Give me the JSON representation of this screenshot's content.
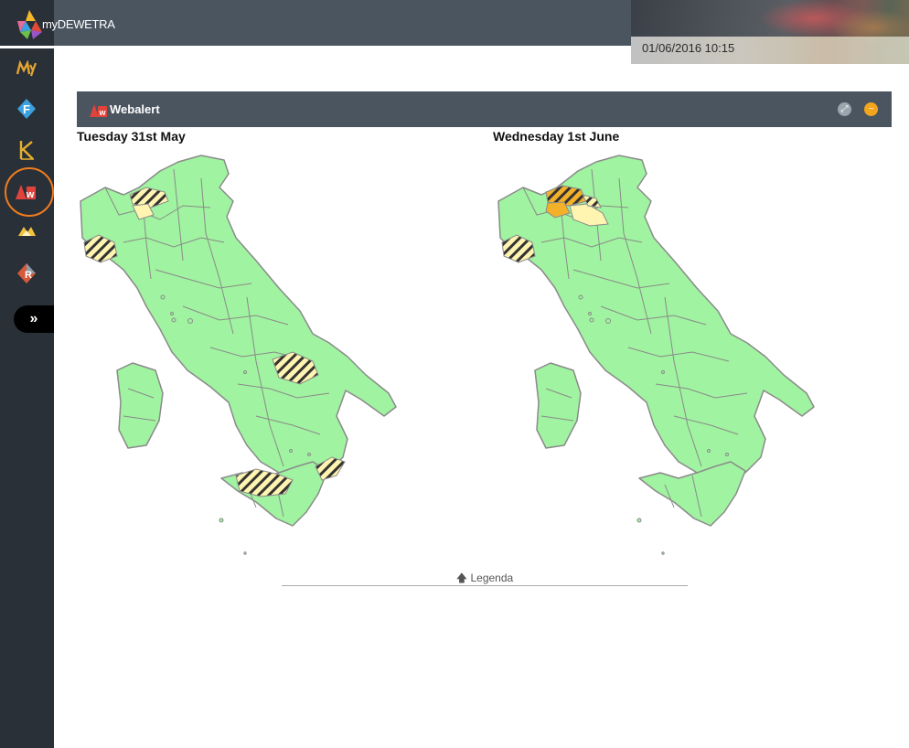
{
  "app": {
    "brand": "myDEWETRA",
    "timestamp": "01/06/2016 10:15"
  },
  "sidebar": {
    "items": [
      {
        "name": "my-dewetra",
        "glyph": "My",
        "color": "#e5a531"
      },
      {
        "name": "forecast",
        "glyph": "F",
        "color": "#3aa0de"
      },
      {
        "name": "k-tool",
        "glyph": "K",
        "color": "#e7b02e"
      },
      {
        "name": "webalert",
        "glyph": "w",
        "color": "#e0433c"
      },
      {
        "name": "alert-tool",
        "glyph": "A",
        "color": "#f3c13c"
      },
      {
        "name": "report",
        "glyph": "R",
        "color": "#d65a3a"
      }
    ],
    "expand_glyph": "»"
  },
  "panel": {
    "title": "Webalert",
    "icon": "webalert-logo"
  },
  "days": [
    {
      "title": "Tuesday 31st May"
    },
    {
      "title": "Wednesday 1st June"
    }
  ],
  "colors": {
    "region_green": "#a0f3a0",
    "stroke_gray": "#8a8a8a",
    "alert_yellow": "#fff5b0",
    "alert_orange": "#f3b12a",
    "accent_orange": "#f07d1e"
  },
  "legend": {
    "label": "Legenda"
  }
}
